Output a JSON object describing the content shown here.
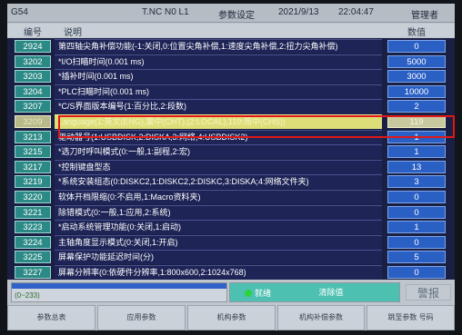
{
  "header": {
    "channel": "G54",
    "mode": "T.NC N0 L1",
    "screen_title": "参数设定",
    "date": "2021/9/13",
    "time": "22:04:47",
    "user": "管理者"
  },
  "columns": {
    "number": "编号",
    "description": "说明",
    "value": "数值"
  },
  "rows": [
    {
      "num": "2924",
      "desc": "第四轴尖角补偿功能(-1:关闭,0:位置尖角补偿,1:速度尖角补偿,2:扭力尖角补偿)",
      "val": "0"
    },
    {
      "num": "3202",
      "desc": "*I/O扫瞄时间(0.001 ms)",
      "val": "5000"
    },
    {
      "num": "3203",
      "desc": "*插补时间(0.001 ms)",
      "val": "3000"
    },
    {
      "num": "3204",
      "desc": "*PLC扫瞄时间(0.001 ms)",
      "val": "10000"
    },
    {
      "num": "3207",
      "desc": "*C/S界面版本编号(1:百分比,2:段数)",
      "val": "2"
    },
    {
      "num": "3209",
      "desc": "Language(1:英文(ENG),繁中(CHT),(2:LOCAL),119:简中(CHS))",
      "val": "119",
      "selected": true
    },
    {
      "num": "3213",
      "desc": "驱动器号(1:USBDISK,2:DISKA,3:网络,4:USBDISK2)",
      "val": "1"
    },
    {
      "num": "3215",
      "desc": "*选刀时呼叫模式(0:一般,1:副程,2:宏)",
      "val": "1"
    },
    {
      "num": "3217",
      "desc": "*控制键盘型态",
      "val": "13"
    },
    {
      "num": "3219",
      "desc": "*系统安装组态(0:DISKC2,1:DISKC2,2:DISKC,3:DISKA;4:网络文件夹)",
      "val": "3"
    },
    {
      "num": "3220",
      "desc": "软体开档限缩(0:不启用,1:Macro资料夹)",
      "val": "0"
    },
    {
      "num": "3221",
      "desc": "除错模式(0:一般,1:应用,2:系统)",
      "val": "0"
    },
    {
      "num": "3223",
      "desc": "*启动系统管理功能(0:关闭,1:启动)",
      "val": "1"
    },
    {
      "num": "3224",
      "desc": "主轴角度显示模式(0:关闭,1:开启)",
      "val": "0"
    },
    {
      "num": "3225",
      "desc": "屏幕保护功能延迟时间(分)",
      "val": "5"
    },
    {
      "num": "3227",
      "desc": "屏幕分辨率(0:依硬件分辨率,1:800x600,2:1024x768)",
      "val": "0"
    }
  ],
  "input": {
    "range": "(0~233)",
    "status_label": "就绪",
    "clear_label": "清除值"
  },
  "alarm_label": "警报",
  "softkeys": [
    "参数总表",
    "应用参数",
    "机构参数",
    "机构补偿参数",
    "跳至参数 号码"
  ],
  "colors": {
    "table_bg": "#1a1f44",
    "number_cell": "#2c8a86",
    "value_cell": "#2a5fc4",
    "selected_row": "#dede78",
    "highlight_box": "#e01818"
  }
}
